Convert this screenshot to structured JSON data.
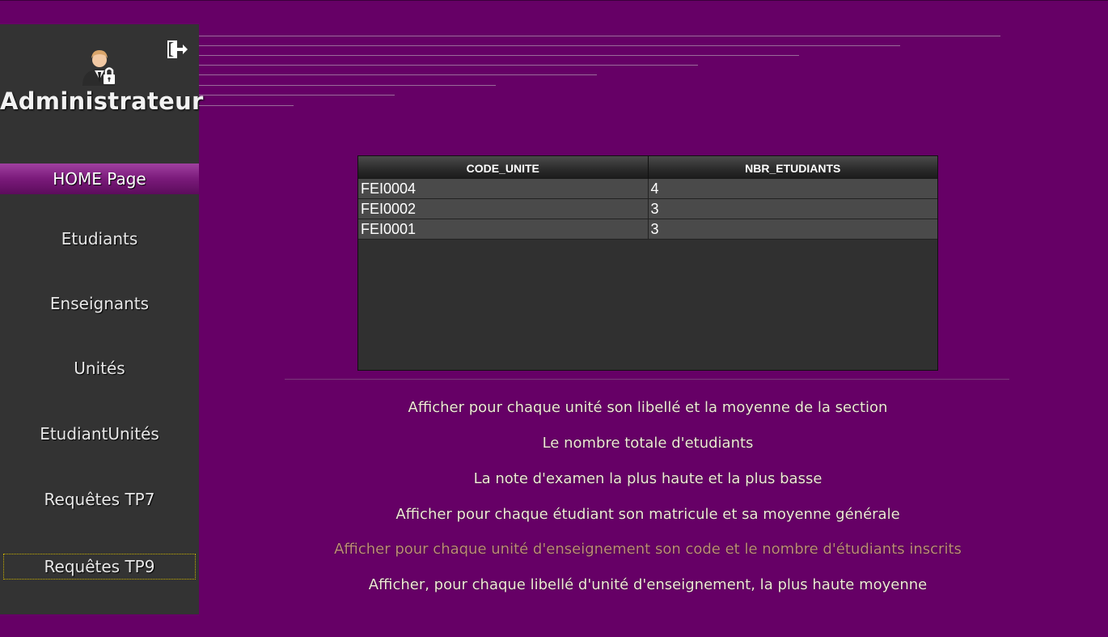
{
  "sidebar": {
    "title": "Administrateur",
    "nav": [
      {
        "label": "HOME Page"
      },
      {
        "label": "Etudiants"
      },
      {
        "label": "Enseignants"
      },
      {
        "label": "Unités"
      },
      {
        "label": "EtudiantUnités"
      },
      {
        "label": "Requêtes TP7"
      },
      {
        "label": "Requêtes TP9"
      }
    ]
  },
  "table": {
    "columns": [
      "CODE_UNITE",
      "NBR_ETUDIANTS"
    ],
    "rows": [
      [
        "FEI0004",
        "4"
      ],
      [
        "FEI0002",
        "3"
      ],
      [
        "FEI0001",
        "3"
      ]
    ]
  },
  "queries": [
    {
      "label": "Afficher pour chaque unité son libellé et la moyenne de la section"
    },
    {
      "label": "Le nombre totale d'etudiants"
    },
    {
      "label": "La note d'examen la plus haute et la plus basse"
    },
    {
      "label": "Afficher pour chaque étudiant son matricule et sa moyenne générale"
    },
    {
      "label": "Afficher pour chaque unité d'enseignement son code et le nombre d'étudiants inscrits"
    },
    {
      "label": "Afficher, pour chaque libellé d'unité d'enseignement, la plus haute moyenne"
    }
  ],
  "colors": {
    "page_background": "#660066",
    "sidebar_background": "#333333",
    "active_nav": "#7a1a7a",
    "table_cell": "#4a4a4a",
    "visited_link": "#c08a7a"
  },
  "icons": {
    "logout": "logout-icon",
    "admin": "admin-avatar-icon"
  }
}
